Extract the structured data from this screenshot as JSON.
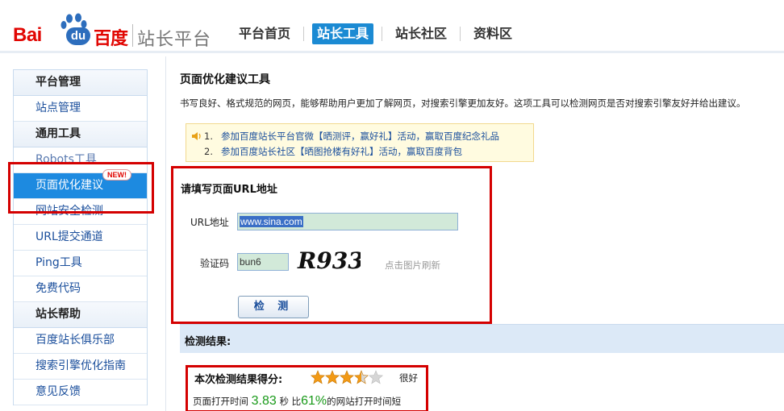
{
  "header": {
    "logo_bai": "Bai",
    "logo_du": "du",
    "logo_cn": "百度",
    "site_name": "站长平台",
    "nav": [
      {
        "label": "平台首页",
        "active": false
      },
      {
        "label": "站长工具",
        "active": true
      },
      {
        "label": "站长社区",
        "active": false
      },
      {
        "label": "资料区",
        "active": false
      }
    ]
  },
  "sidebar": {
    "sections": [
      {
        "title": "平台管理",
        "items": [
          "站点管理"
        ]
      },
      {
        "title": "通用工具",
        "items": [
          "Robots工具",
          "页面优化建议",
          "网站安全检测",
          "URL提交通道",
          "Ping工具",
          "免费代码"
        ]
      },
      {
        "title": "站长帮助",
        "items": [
          "百度站长俱乐部",
          "搜索引擎优化指南",
          "意见反馈"
        ]
      }
    ],
    "active_item": "页面优化建议",
    "new_badge": "NEW!"
  },
  "main": {
    "title": "页面优化建议工具",
    "description": "书写良好、格式规范的网页，能够帮助用户更加了解网页，对搜索引擎更加友好。这项工具可以检测网页是否对搜索引擎友好并给出建议。",
    "notices": [
      {
        "num": "1.",
        "text": "参加百度站长平台官微【晒测评，赢好礼】活动，赢取百度纪念礼品"
      },
      {
        "num": "2.",
        "text": "参加百度站长社区【晒图抢楼有好礼】活动，赢取百度背包"
      }
    ],
    "form": {
      "title": "请填写页面URL地址",
      "url_label": "URL地址",
      "url_value": "www.sina.com",
      "captcha_label": "验证码",
      "captcha_value": "bun6",
      "captcha_image_text": "R933",
      "refresh_hint": "点击图片刷新",
      "submit_label": "检 测"
    },
    "result": {
      "section_title": "检测结果:",
      "score_label": "本次检测结果得分:",
      "stars": 3.5,
      "stars_max": 5,
      "rating_text": "很好",
      "speed_prefix": "页面打开时间",
      "load_time": "3.83",
      "seconds_unit": "秒",
      "compare_prefix": "比",
      "faster_percent": "61%",
      "compare_suffix": "的网站打开时间短"
    }
  },
  "colors": {
    "accent_blue": "#1b8ad3",
    "highlight_red": "#d40000",
    "link_blue": "#1b4f9c",
    "star_orange": "#f29a16",
    "score_green": "#1a9a1a"
  }
}
